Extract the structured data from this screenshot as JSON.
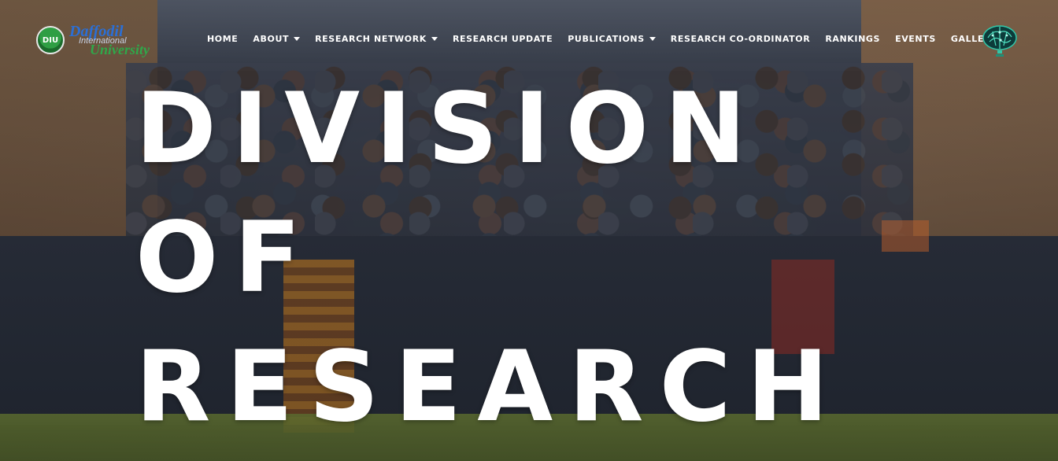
{
  "brand": {
    "badge": "DIU",
    "name_line1": "Daffodil",
    "name_line2": "International",
    "name_line3": "University",
    "primary_color": "#2b6fd6",
    "secondary_color": "#2fa84a"
  },
  "nav": {
    "items": [
      {
        "label": "HOME",
        "dropdown": false
      },
      {
        "label": "ABOUT",
        "dropdown": true
      },
      {
        "label": "RESEARCH NETWORK",
        "dropdown": true
      },
      {
        "label": "RESEARCH UPDATE",
        "dropdown": false
      },
      {
        "label": "PUBLICATIONS",
        "dropdown": true
      },
      {
        "label": "RESEARCH CO-ORDINATOR",
        "dropdown": false
      },
      {
        "label": "RANKINGS",
        "dropdown": false
      },
      {
        "label": "EVENTS",
        "dropdown": false
      },
      {
        "label": "GALLERY",
        "dropdown": true
      }
    ]
  },
  "brain_logo_icon": "brain-network-icon",
  "hero": {
    "line1": "DIVISION",
    "line2": "OF",
    "line3": "RESEARCH"
  }
}
